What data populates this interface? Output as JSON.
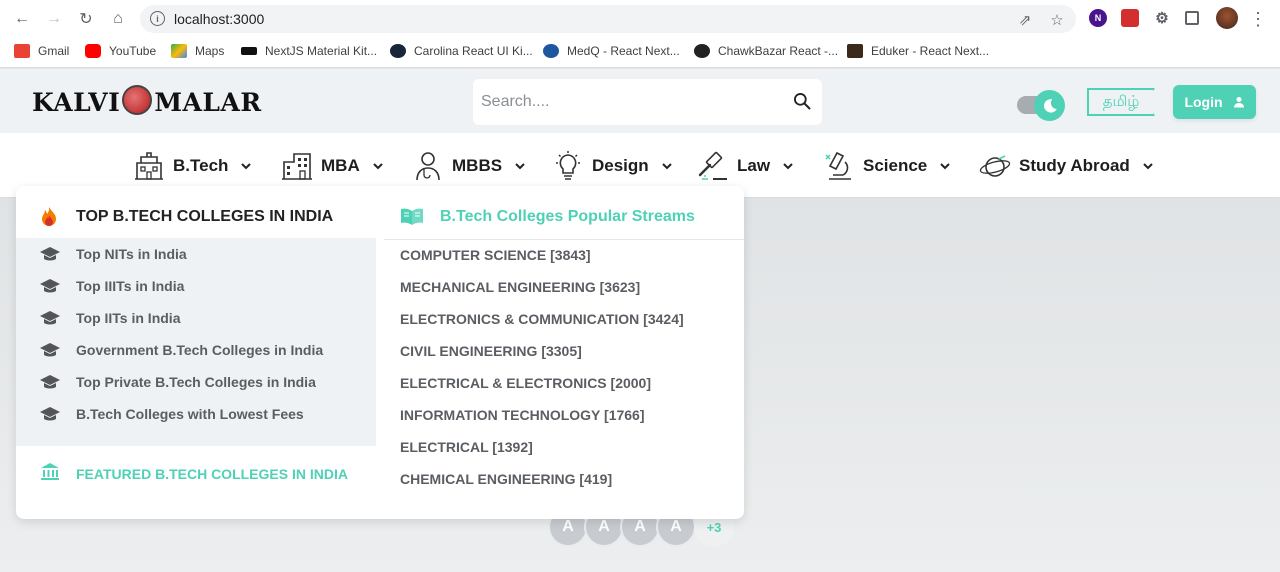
{
  "browser": {
    "url": "localhost:3000",
    "bookmarks": [
      {
        "label": "Gmail",
        "icon": "gmail-icon",
        "color": "#ea4335"
      },
      {
        "label": "YouTube",
        "icon": "youtube-icon",
        "color": "#ff0000"
      },
      {
        "label": "Maps",
        "icon": "maps-icon",
        "color": "#34a853"
      },
      {
        "label": "NextJS Material Kit...",
        "icon": "nextjs-kit-icon",
        "color": "#111111"
      },
      {
        "label": "Carolina React UI Ki...",
        "icon": "react-icon",
        "color": "#17263a"
      },
      {
        "label": "MedQ - React Next...",
        "icon": "medq-icon",
        "color": "#1e56a0"
      },
      {
        "label": "ChawkBazar React -...",
        "icon": "chawkbazar-icon",
        "color": "#222222"
      },
      {
        "label": "Eduker - React Next...",
        "icon": "eduker-icon",
        "color": "#3b2a1a"
      }
    ],
    "extension_letter": "N"
  },
  "header": {
    "logo_text_left": "KALVI",
    "logo_text_right": "MALAR",
    "search_placeholder": "Search....",
    "language_label": "தமிழ்",
    "login_label": "Login",
    "accent_color": "#4fd1b5"
  },
  "nav": {
    "items": [
      {
        "label": "B.Tech",
        "icon": "building-icon"
      },
      {
        "label": "MBA",
        "icon": "office-building-icon"
      },
      {
        "label": "MBBS",
        "icon": "doctor-icon"
      },
      {
        "label": "Design",
        "icon": "lightbulb-icon"
      },
      {
        "label": "Law",
        "icon": "gavel-icon"
      },
      {
        "label": "Science",
        "icon": "microscope-icon"
      },
      {
        "label": "Study Abroad",
        "icon": "plane-globe-icon"
      }
    ]
  },
  "mega_menu": {
    "left_title": "TOP B.TECH COLLEGES IN INDIA",
    "left_items": [
      "Top NITs in India",
      "Top IIITs in India",
      "Top IITs in India",
      "Government B.Tech Colleges in India",
      "Top Private B.Tech Colleges in India",
      "B.Tech Colleges with Lowest Fees"
    ],
    "featured_label": "FEATURED B.TECH COLLEGES IN INDIA",
    "right_title": "B.Tech Colleges Popular Streams",
    "streams": [
      "COMPUTER SCIENCE [3843]",
      "MECHANICAL ENGINEERING [3623]",
      "ELECTRONICS & COMMUNICATION [3424]",
      "CIVIL ENGINEERING [3305]",
      "ELECTRICAL & ELECTRONICS [2000]",
      "INFORMATION TECHNOLOGY [1766]",
      "ELECTRICAL [1392]",
      "CHEMICAL ENGINEERING [419]"
    ]
  },
  "avatars": {
    "letters": [
      "A",
      "A",
      "A",
      "A"
    ],
    "more_label": "+3"
  }
}
